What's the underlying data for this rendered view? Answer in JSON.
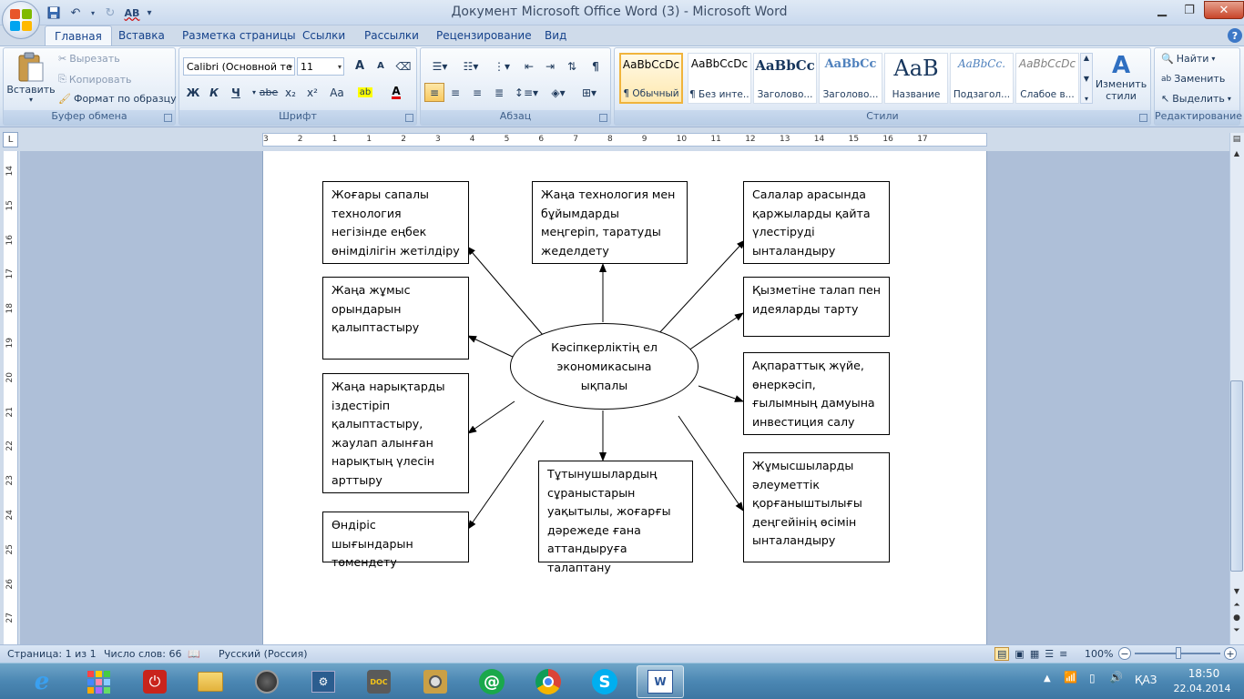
{
  "window": {
    "title": "Документ Microsoft Office Word (3) - Microsoft Word",
    "minimize": "▁",
    "restore": "❐",
    "close": "✕"
  },
  "qat": {
    "undo_icon": "↶",
    "redo_icon": "↻"
  },
  "tabs": [
    "Главная",
    "Вставка",
    "Разметка страницы",
    "Ссылки",
    "Рассылки",
    "Рецензирование",
    "Вид"
  ],
  "ribbon": {
    "clipboard": {
      "label": "Буфер обмена",
      "paste": "Вставить",
      "cut": "Вырезать",
      "copy": "Копировать",
      "format_painter": "Формат по образцу"
    },
    "font": {
      "label": "Шрифт",
      "font_name": "Calibri (Основной те",
      "font_size": "11",
      "bold": "Ж",
      "italic": "К",
      "underline": "Ч",
      "strike": "abe",
      "subscript": "x₂",
      "superscript": "x²",
      "case": "Aa",
      "grow": "A",
      "shrink": "A"
    },
    "paragraph": {
      "label": "Абзац",
      "pilcrow": "¶"
    },
    "styles": {
      "label": "Стили",
      "items": [
        {
          "sample": "AaBbCcDc",
          "name": "¶ Обычный"
        },
        {
          "sample": "AaBbCcDc",
          "name": "¶ Без инте..."
        },
        {
          "sample": "AaBbCc",
          "name": "Заголово..."
        },
        {
          "sample": "AaBbCc",
          "name": "Заголово..."
        },
        {
          "sample": "AaB",
          "name": "Название"
        },
        {
          "sample": "AaBbCc.",
          "name": "Подзагол..."
        },
        {
          "sample": "AaBbCcDc",
          "name": "Слабое в..."
        }
      ],
      "change_styles": "Изменить стили"
    },
    "editing": {
      "label": "Редактирование",
      "find": "Найти",
      "replace": "Заменить",
      "select": "Выделить"
    }
  },
  "ruler": {
    "h_ticks": [
      "3",
      "2",
      "1",
      "1",
      "2",
      "3",
      "4",
      "5",
      "6",
      "7",
      "8",
      "9",
      "10",
      "11",
      "12",
      "13",
      "14",
      "15",
      "16",
      "17"
    ],
    "v_ticks": [
      "14",
      "15",
      "16",
      "17",
      "18",
      "19",
      "20",
      "21",
      "22",
      "23",
      "24",
      "25",
      "26",
      "27"
    ]
  },
  "diagram": {
    "center": "Кәсіпкерліктің ел экономикасына ықпалы",
    "boxes": {
      "top_left": "Жоғары сапалы технология негізінде еңбек өнімділігін жетілдіру",
      "top_center": "Жаңа технология мен бұйымдарды меңгеріп, таратуды жеделдету",
      "top_right": "Салалар арасында қаржыларды қайта үлестіруді ынталандыру",
      "mid_left_1": "Жаңа жұмыс орындарын қалыптастыру",
      "mid_right_1": "Қызметіне талап пен идеяларды тарту",
      "mid_left_2": "Жаңа нарықтарды іздестіріп қалыптастыру, жаулап алынған нарықтың үлесін арттыру",
      "mid_right_2": "Ақпараттық жүйе, өнеркәсіп, ғылымның дамуына инвестиция салу",
      "bottom_left": "Өндіріс шығындарын төмендету",
      "bottom_center": "Тұтынушылардың сұраныстарын уақытылы, жоғарғы дәрежеде ғана аттандыруға талаптану",
      "bottom_right": "Жұмысшыларды әлеуметтік қорғаныштылығы деңгейінің өсімін ынталандыру"
    }
  },
  "status": {
    "page": "Страница: 1 из 1",
    "words": "Число слов: 66",
    "language": "Русский (Россия)",
    "zoom": "100%"
  },
  "taskbar": {
    "language": "ҚАЗ",
    "time": "18:50",
    "date": "22.04.2014"
  }
}
